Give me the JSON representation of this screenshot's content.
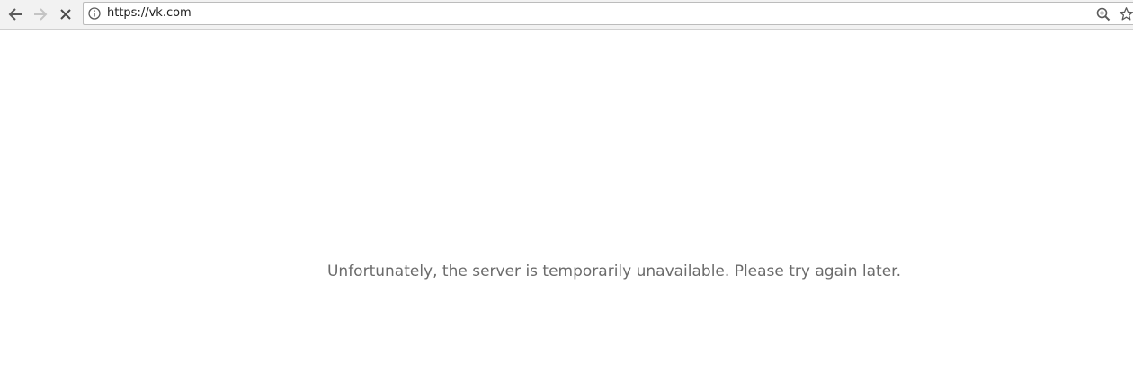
{
  "browser": {
    "address_bar": {
      "url": "https://vk.com"
    },
    "icons": {
      "back": "arrow-left-icon",
      "forward": "arrow-right-icon",
      "stop": "close-icon",
      "site_info": "info-icon",
      "zoom": "zoom-in-icon",
      "bookmark": "star-icon"
    }
  },
  "page": {
    "message": "Unfortunately, the server is temporarily unavailable. Please try again later."
  },
  "colors": {
    "message_text": "#6b6b6b",
    "toolbar_bg": "#f2f2f2"
  }
}
